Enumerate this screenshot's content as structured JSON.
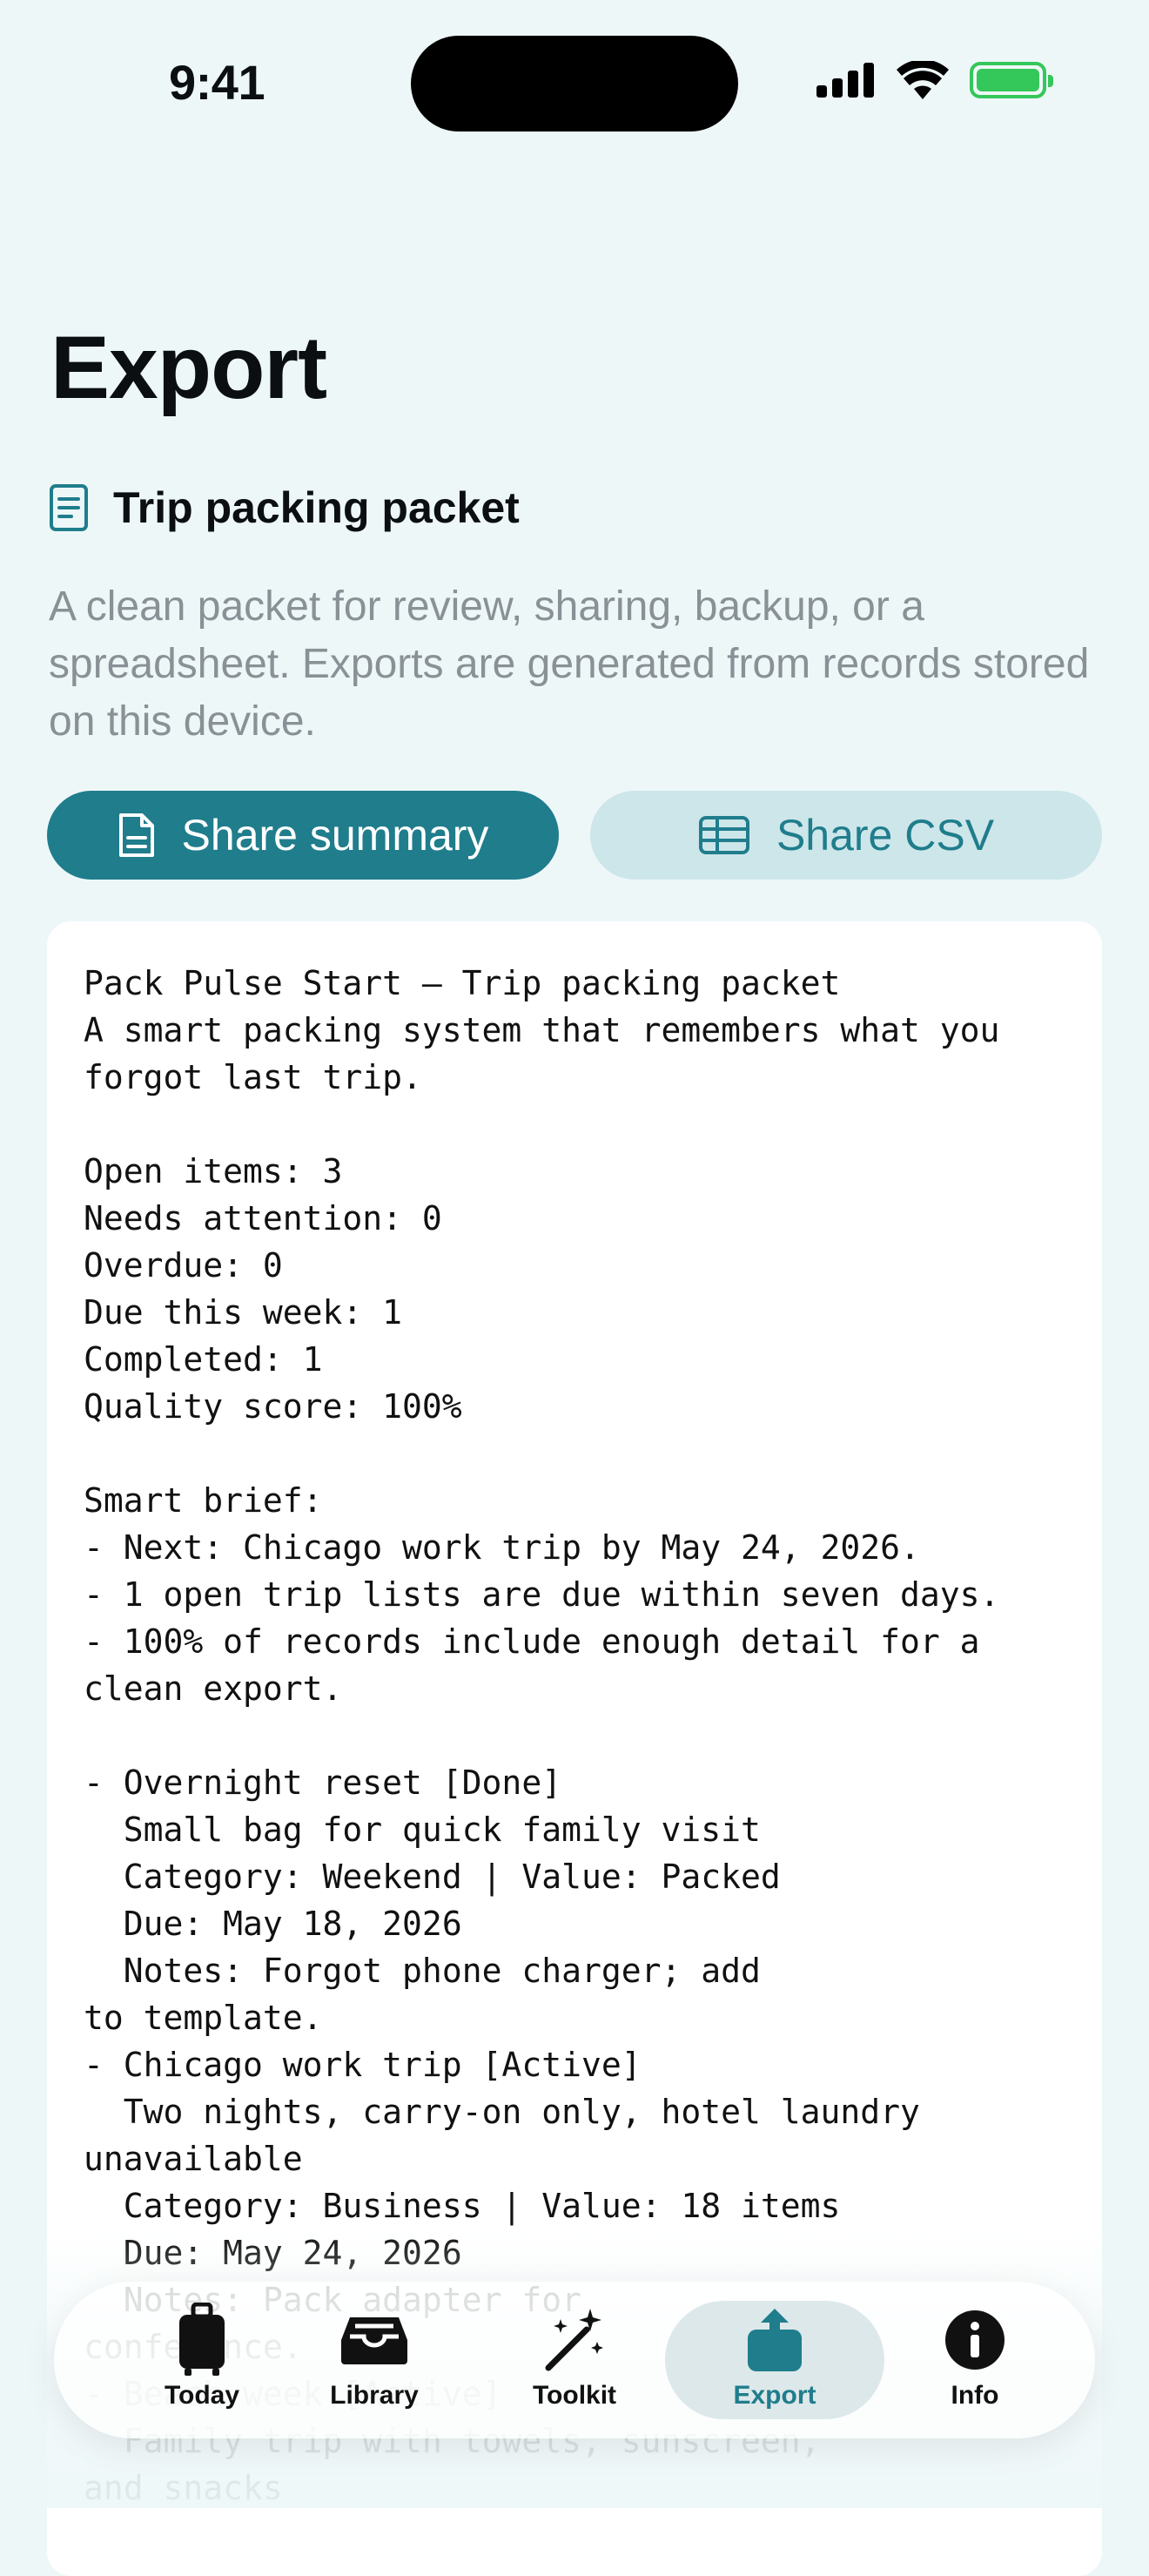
{
  "status_bar": {
    "time": "9:41"
  },
  "page": {
    "title": "Export"
  },
  "section": {
    "title": "Trip packing packet",
    "icon": "document-text-icon",
    "description": "A clean packet for review, sharing, backup, or a spreadsheet. Exports are generated from records stored on this device."
  },
  "actions": {
    "share_summary": "Share summary",
    "share_csv": "Share CSV"
  },
  "preview": {
    "text": "Pack Pulse Start — Trip packing packet\nA smart packing system that remembers what you forgot last trip.\n\nOpen items: 3\nNeeds attention: 0\nOverdue: 0\nDue this week: 1\nCompleted: 1\nQuality score: 100%\n\nSmart brief:\n- Next: Chicago work trip by May 24, 2026.\n- 1 open trip lists are due within seven days.\n- 100% of records include enough detail for a clean export.\n\n- Overnight reset [Done]\n  Small bag for quick family visit\n  Category: Weekend | Value: Packed\n  Due: May 18, 2026\n  Notes: Forgot phone charger; add\nto template.\n- Chicago work trip [Active]\n  Two nights, carry-on only, hotel laundry\nunavailable\n  Category: Business | Value: 18 items\n  Due: May 24, 2026\n  Notes: Pack adapter for\nconference.\n- Beach week [Active]\n  Family trip with towels, sunscreen,\nand snacks"
  },
  "tabs": [
    {
      "label": "Today",
      "icon": "suitcase-icon"
    },
    {
      "label": "Library",
      "icon": "tray-icon"
    },
    {
      "label": "Toolkit",
      "icon": "magic-wand-icon"
    },
    {
      "label": "Export",
      "icon": "share-icon",
      "active": true
    },
    {
      "label": "Info",
      "icon": "info-icon"
    }
  ],
  "colors": {
    "accent": "#1f7d8c",
    "background": "#eef7f8",
    "battery": "#34c759"
  }
}
